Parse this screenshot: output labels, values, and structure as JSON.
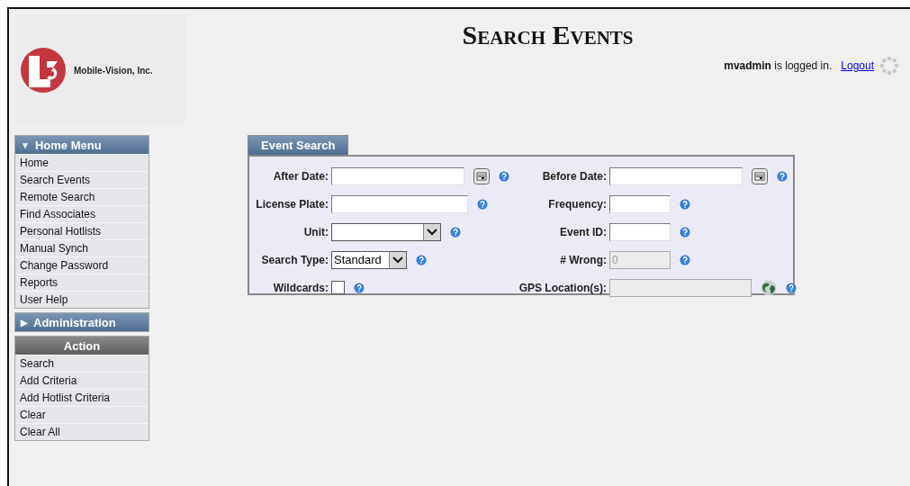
{
  "header": {
    "company": "Mobile-Vision, Inc.",
    "title": "Search Events",
    "user": "mvadmin",
    "login_text": "is logged in.",
    "logout": "Logout"
  },
  "sidebar": [
    {
      "title": "Home Menu",
      "kind": "menu",
      "arrow": "▼",
      "expanded": true,
      "items": [
        "Home",
        "Search Events",
        "Remote Search",
        "Find Associates",
        "Personal Hotlists",
        "Manual Synch",
        "Change Password",
        "Reports",
        "User Help"
      ]
    },
    {
      "title": "Administration",
      "kind": "menu",
      "arrow": "▶"
    },
    {
      "title": "Action",
      "kind": "action",
      "items": [
        "Search",
        "Add Criteria",
        "Add Hotlist Criteria",
        "Clear",
        "Clear All"
      ]
    }
  ],
  "form": {
    "tab": "Event Search",
    "left": [
      {
        "label": "After Date:",
        "kind": "date",
        "disabled": false
      },
      {
        "label": "License Plate:",
        "kind": "text",
        "disabled": false
      },
      {
        "label": "Unit:",
        "kind": "select",
        "disabled": false
      },
      {
        "label": "Search Type:",
        "kind": "select",
        "value": "Standard",
        "disabled": false
      },
      {
        "label": "Wildcards:",
        "kind": "checkbox",
        "checked": false,
        "disabled": false
      }
    ],
    "right": [
      {
        "label": "Before Date:",
        "kind": "date",
        "disabled": false
      },
      {
        "label": "Frequency:",
        "kind": "text",
        "disabled": false
      },
      {
        "label": "Event ID:",
        "kind": "text",
        "disabled": false
      },
      {
        "label": "# Wrong:",
        "kind": "text",
        "value": "0",
        "disabled": true
      },
      {
        "label": "GPS Location(s):",
        "kind": "gps",
        "disabled": true
      }
    ]
  }
}
